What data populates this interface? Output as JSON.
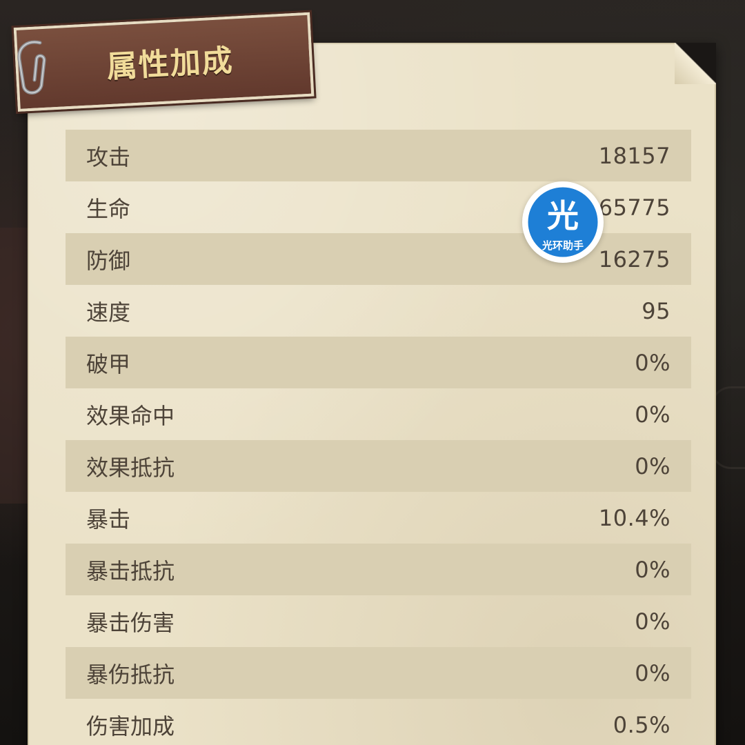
{
  "panel": {
    "title": "属性加成"
  },
  "stats": [
    {
      "label": "攻击",
      "value": "18157"
    },
    {
      "label": "生命",
      "value": "165775"
    },
    {
      "label": "防御",
      "value": "16275"
    },
    {
      "label": "速度",
      "value": "95"
    },
    {
      "label": "破甲",
      "value": "0%"
    },
    {
      "label": "效果命中",
      "value": "0%"
    },
    {
      "label": "效果抵抗",
      "value": "0%"
    },
    {
      "label": "暴击",
      "value": "10.4%"
    },
    {
      "label": "暴击抵抗",
      "value": "0%"
    },
    {
      "label": "暴击伤害",
      "value": "0%"
    },
    {
      "label": "暴伤抵抗",
      "value": "0%"
    },
    {
      "label": "伤害加成",
      "value": "0.5%"
    }
  ],
  "watermark": {
    "glyph": "光",
    "caption": "光环助手",
    "color": "#1e7fd6"
  },
  "colors": {
    "paper": "#ebe2c8",
    "row_shade": "#d9cfb2",
    "text": "#4d4338",
    "plaque": "#6b4234",
    "title_text": "#f1dc9a"
  },
  "icons": [
    "paperclip-icon",
    "page-curl-icon",
    "watermark-logo-icon"
  ]
}
